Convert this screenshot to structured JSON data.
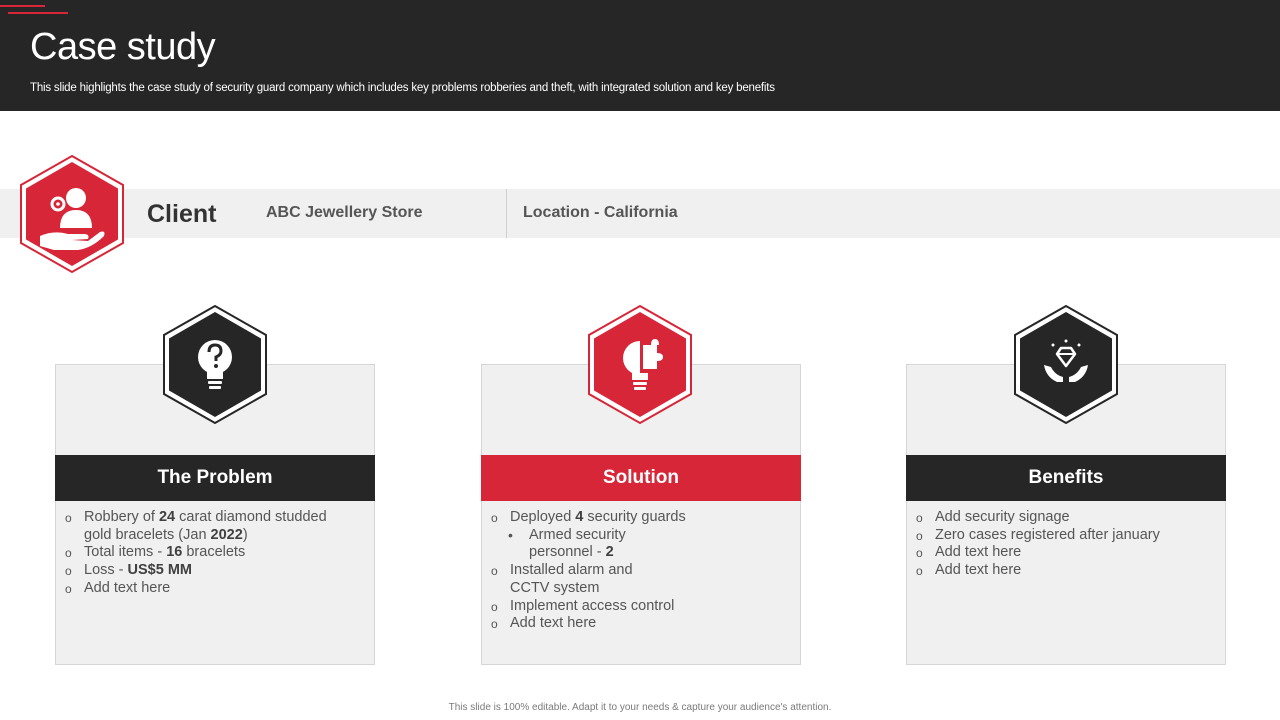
{
  "slide": {
    "title": "Case study",
    "subtitle": "This slide highlights the case study of security guard company which includes key problems robberies and theft, with integrated solution and key benefits",
    "footer": "This slide is 100% editable. Adapt it to your needs & capture your audience's attention."
  },
  "colors": {
    "accent": "#d72638",
    "dark": "#262626",
    "panel": "#f0f0f0"
  },
  "client": {
    "label": "Client",
    "name": "ABC Jewellery Store",
    "location": "Location - California",
    "icon": "client-hand-person-gear-icon"
  },
  "problem": {
    "heading": "The Problem",
    "icon": "question-bulb-icon",
    "items": [
      {
        "pre": "Robbery of ",
        "b1": "24",
        "mid": " carat diamond studded gold bracelets (Jan ",
        "b2": "2022",
        "post": ")"
      },
      {
        "pre": "Total items - ",
        "b1": "16",
        "post": " bracelets"
      },
      {
        "pre": "Loss - ",
        "b1": "US$5 MM"
      },
      {
        "pre": "Add text here"
      }
    ]
  },
  "solution": {
    "heading": "Solution",
    "icon": "puzzle-bulb-icon",
    "items": [
      {
        "pre": "Deployed ",
        "b1": "4",
        "post": " security guards"
      },
      {
        "pre": "Armed security personnel - ",
        "b1": "2",
        "sub": true
      },
      {
        "pre": "Installed alarm and CCTV system"
      },
      {
        "pre": "Implement access control"
      },
      {
        "pre": "Add text here"
      }
    ]
  },
  "benefits": {
    "heading": "Benefits",
    "icon": "diamond-hands-icon",
    "items": [
      {
        "pre": "Add security signage"
      },
      {
        "pre": "Zero cases registered after january"
      },
      {
        "pre": "Add text here"
      },
      {
        "pre": "Add text here"
      }
    ]
  }
}
